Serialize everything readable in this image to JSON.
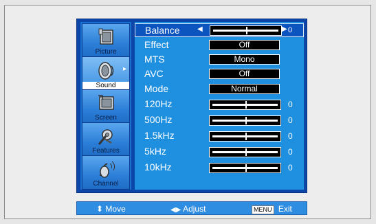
{
  "sidebar": {
    "items": [
      {
        "label": "Picture",
        "icon": "picture-icon"
      },
      {
        "label": "Sound",
        "icon": "speaker-icon",
        "active": true
      },
      {
        "label": "Screen",
        "icon": "screen-icon"
      },
      {
        "label": "Features",
        "icon": "features-icon"
      },
      {
        "label": "Channel",
        "icon": "antenna-icon"
      }
    ]
  },
  "sound_menu": {
    "balance": {
      "label": "Balance",
      "value": "0",
      "level": 0.5
    },
    "effect": {
      "label": "Effect",
      "value": "Off"
    },
    "mts": {
      "label": "MTS",
      "value": "Mono"
    },
    "avc": {
      "label": "AVC",
      "value": "Off"
    },
    "mode": {
      "label": "Mode",
      "value": "Normal"
    },
    "eq": [
      {
        "label": "120Hz",
        "value": "0",
        "level": 0.5
      },
      {
        "label": "500Hz",
        "value": "0",
        "level": 0.5
      },
      {
        "label": "1.5kHz",
        "value": "0",
        "level": 0.5
      },
      {
        "label": "5kHz",
        "value": "0",
        "level": 0.5
      },
      {
        "label": "10kHz",
        "value": "0",
        "level": 0.5
      }
    ]
  },
  "helpbar": {
    "move": "Move",
    "adjust": "Adjust",
    "menu_key": "MENU",
    "exit": "Exit"
  },
  "colors": {
    "panel": "#0c46a8",
    "content_bg": "#1f8fe0",
    "sidebar_bg": "#1a6fd0",
    "value_bg": "#000000"
  }
}
